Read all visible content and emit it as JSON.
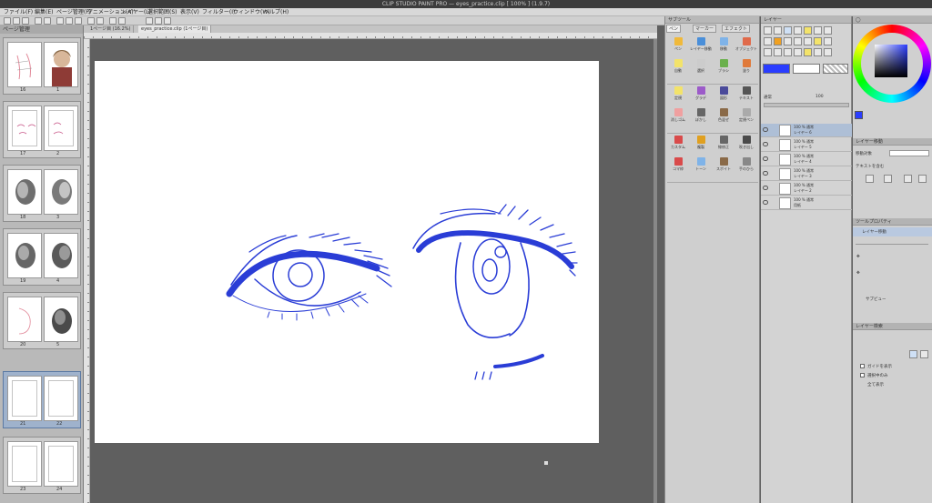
{
  "window": {
    "title": "CLIP STUDIO PAINT PRO — eyes_practice.clip [ 100% ] (1.9.7)"
  },
  "menu": [
    "ファイル(F)",
    "編集(E)",
    "ページ管理(P)",
    "アニメーション(A)",
    "レイヤー(L)",
    "選択範囲(S)",
    "表示(V)",
    "フィルター(I)",
    "ウィンドウ(W)",
    "ヘルプ(H)"
  ],
  "navigator": {
    "title": "ページ管理",
    "pages": [
      {
        "l": "16",
        "r": "1"
      },
      {
        "l": "17",
        "r": "2"
      },
      {
        "l": "18",
        "r": "3"
      },
      {
        "l": "19",
        "r": "4"
      },
      {
        "l": "20",
        "r": "5"
      },
      {
        "l": "21",
        "r": "22"
      },
      {
        "l": "23",
        "r": "24"
      }
    ]
  },
  "document_tabs": [
    "1ページ目 (16.2%)",
    "eyes_practice.clip (1ページ目)"
  ],
  "tool_palette": {
    "title": "サブツール",
    "tabs": [
      "ペン",
      "マーカー",
      "エフェクト"
    ],
    "tools": [
      "ペン",
      "レイヤー移動",
      "移動",
      "オブジェクト",
      "自動",
      "選択",
      "ブラシ",
      "塗り",
      "定規",
      "グラデ",
      "図形",
      "テキスト",
      "消しゴム",
      "ぼかし",
      "色混ぜ",
      "定規ペン",
      "カスタム",
      "複製",
      "線修正",
      "吹き出し",
      "コマ枠",
      "トーン",
      "スポイト",
      "手のひら"
    ]
  },
  "layer_panel": {
    "title": "レイヤー",
    "blend_mode": "通常",
    "opacity": "100",
    "layers": [
      {
        "name": "100 % 通常",
        "sub": "レイヤー 6"
      },
      {
        "name": "100 % 通常",
        "sub": "レイヤー 5"
      },
      {
        "name": "100 % 通常",
        "sub": "レイヤー 4"
      },
      {
        "name": "100 % 通常",
        "sub": "レイヤー 3"
      },
      {
        "name": "100 % 通常",
        "sub": "レイヤー 2"
      },
      {
        "name": "100 % 通常",
        "sub": "用紙"
      }
    ]
  },
  "tool_property": {
    "title": "ツールプロパティ",
    "label1": "レイヤー移動",
    "label2": "移動対象",
    "label3": "テキストを含む",
    "label4": "サブビュー"
  },
  "layer_search": {
    "title": "レイヤー検索",
    "options": [
      "ガイドを表示",
      "選択中のみ",
      "全て表示"
    ]
  },
  "colors": {
    "main": "#2a3dff",
    "line": "#2a3dd6"
  }
}
